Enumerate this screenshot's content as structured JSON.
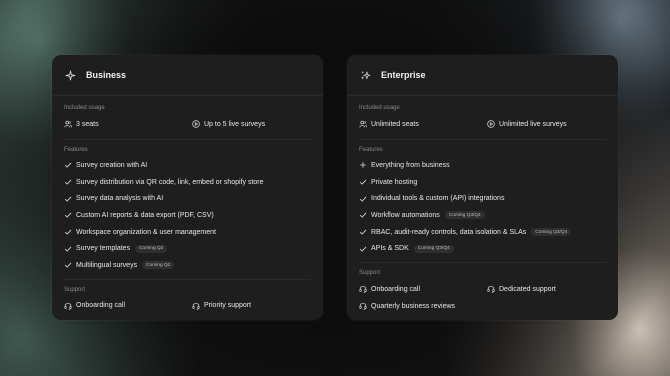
{
  "business": {
    "title": "Business",
    "icon": "sparkle-icon",
    "usage_label": "Included usage",
    "usage": [
      {
        "icon": "users-icon",
        "text": "3 seats"
      },
      {
        "icon": "play-circle-icon",
        "text": "Up to 5 live surveys"
      }
    ],
    "features_label": "Features",
    "features": [
      {
        "text": "Survey creation with AI",
        "badge": ""
      },
      {
        "text": "Survey distribution via QR code, link, embed or shopify store",
        "badge": ""
      },
      {
        "text": "Survey data analysis with AI",
        "badge": ""
      },
      {
        "text": "Custom AI reports & data export (PDF, CSV)",
        "badge": ""
      },
      {
        "text": "Workspace organization & user management",
        "badge": ""
      },
      {
        "text": "Survey templates",
        "badge": "Coming Q2"
      },
      {
        "text": "Multilingual surveys",
        "badge": "Coming Q2"
      }
    ],
    "support_label": "Support",
    "support": [
      {
        "icon": "headset-icon",
        "text": "Onboarding call"
      },
      {
        "icon": "headset-icon",
        "text": "Priority support"
      }
    ]
  },
  "enterprise": {
    "title": "Enterprise",
    "icon": "sparkles-icon",
    "usage_label": "Included usage",
    "usage": [
      {
        "icon": "users-icon",
        "text": "Unlimited seats"
      },
      {
        "icon": "play-circle-icon",
        "text": "Unlimited live surveys"
      }
    ],
    "features_label": "Features",
    "features": [
      {
        "icon": "plus-icon",
        "text": "Everything from business",
        "badge": ""
      },
      {
        "icon": "check-icon",
        "text": "Private hosting",
        "badge": ""
      },
      {
        "icon": "check-icon",
        "text": "Individual tools & custom (API) integrations",
        "badge": ""
      },
      {
        "icon": "check-icon",
        "text": "Workflow automations",
        "badge": "Coming Q3/Q4"
      },
      {
        "icon": "check-icon",
        "text": "RBAC, audit-ready controls, data isolation & SLAs",
        "badge": "Coming Q3/Q4"
      },
      {
        "icon": "check-icon",
        "text": "APIs & SDK",
        "badge": "Coming Q3/Q4"
      }
    ],
    "support_label": "Support",
    "support": [
      {
        "icon": "headset-icon",
        "text": "Onboarding call"
      },
      {
        "icon": "headset-icon",
        "text": "Dedicated support"
      },
      {
        "icon": "headset-icon",
        "text": "Quarterly business reviews"
      }
    ]
  }
}
